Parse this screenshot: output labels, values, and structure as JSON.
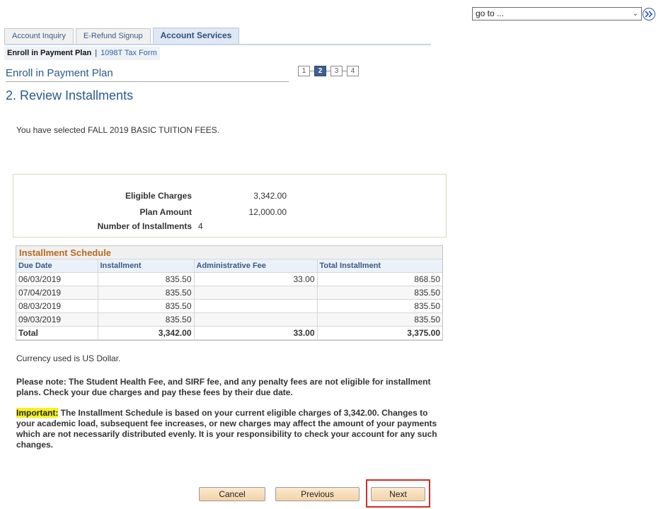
{
  "nav": {
    "goto_label": "go to ...",
    "goto_icon": "double-chevron-right-icon"
  },
  "tabs": [
    {
      "label": "Account Inquiry",
      "active": false
    },
    {
      "label": "E-Refund Signup",
      "active": false
    },
    {
      "label": "Account Services",
      "active": true
    }
  ],
  "subnav": {
    "current": "Enroll in Payment Plan",
    "separator": "|",
    "link": "1098T Tax Form"
  },
  "page": {
    "title": "Enroll in Payment Plan",
    "subtitle": "2. Review Installments",
    "selected_message": "You have selected FALL 2019 BASIC TUITION FEES."
  },
  "steps": {
    "labels": [
      "1",
      "2",
      "3",
      "4"
    ],
    "current": 2
  },
  "summary": {
    "eligible_label": "Eligible Charges",
    "eligible_value": "3,342.00",
    "plan_label": "Plan Amount",
    "plan_value": "12,000.00",
    "installments_label": "Number of Installments",
    "installments_value": "4"
  },
  "schedule": {
    "caption": "Installment Schedule",
    "headers": [
      "Due Date",
      "Installment",
      "Administrative Fee",
      "Total Installment"
    ],
    "rows": [
      [
        "06/03/2019",
        "835.50",
        "33.00",
        "868.50"
      ],
      [
        "07/04/2019",
        "835.50",
        "",
        "835.50"
      ],
      [
        "08/03/2019",
        "835.50",
        "",
        "835.50"
      ],
      [
        "09/03/2019",
        "835.50",
        "",
        "835.50"
      ]
    ],
    "total": [
      "Total",
      "3,342.00",
      "33.00",
      "3,375.00"
    ]
  },
  "currency_note": "Currency used is US Dollar.",
  "please_note": "Please note: The Student Health Fee, and SIRF fee, and any penalty fees are not eligible for installment plans. Check your due charges and pay these fees by their due date.",
  "important": {
    "label": "Important:",
    "text": " The Installment Schedule is based on your current eligible charges of 3,342.00.  Changes to your academic load, subsequent fee increases, or new charges may affect the amount of your payments which are not necessarily distributed evenly.  It is your responsibility to check your account for any such changes."
  },
  "buttons": {
    "cancel": "Cancel",
    "previous": "Previous",
    "next": "Next"
  },
  "colors": {
    "accent": "#2b5a8c",
    "caption": "#b86a1c",
    "highlight": "#f4f21a",
    "focus_box": "#d22b2b"
  }
}
